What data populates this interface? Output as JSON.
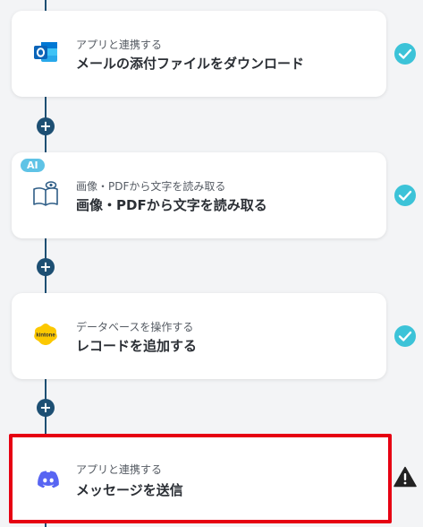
{
  "steps": [
    {
      "app_label": "アプリと連携する",
      "action": "メールの添付ファイルをダウンロード",
      "icon": "outlook-icon",
      "status": "complete",
      "status_color": "#3cc3d8"
    },
    {
      "badge": "AI",
      "app_label": "画像・PDFから文字を読み取る",
      "action": "画像・PDFから文字を読み取る",
      "icon": "ocr-book-icon",
      "status": "complete",
      "status_color": "#3cc3d8"
    },
    {
      "app_label": "データベースを操作する",
      "action": "レコードを追加する",
      "icon": "kintone-icon",
      "logo_text": "kintone",
      "status": "complete",
      "status_color": "#3cc3d8"
    },
    {
      "app_label": "アプリと連携する",
      "action": "メッセージを送信",
      "icon": "discord-icon",
      "status": "warning",
      "highlight_color": "#e60012"
    }
  ],
  "add_step_symbol": "+",
  "colors": {
    "flow_line": "#1d4f73",
    "ai_badge": "#5fc3e6",
    "background": "#f3f4f6"
  }
}
